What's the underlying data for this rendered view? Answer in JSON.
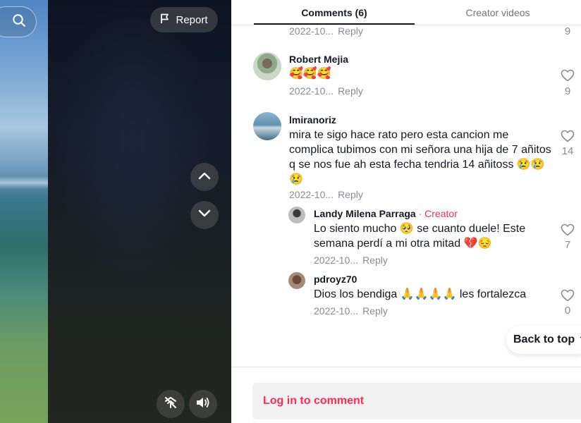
{
  "video": {
    "report_label": "Report"
  },
  "tabs": {
    "comments": "Comments (6)",
    "creator_videos": "Creator videos"
  },
  "comments": [
    {
      "date": "2022-10...",
      "reply_label": "Reply",
      "likes": "9"
    },
    {
      "username": "Robert Mejia",
      "text": "🥰🥰🥰",
      "date": "2022-10...",
      "reply_label": "Reply",
      "likes": "9"
    },
    {
      "username": "lmiranoriz",
      "text": "mira te sigo hace rato pero esta cancion me complica tubimos con mi señora una hija de 7 añitos q se nos fue ah esta fecha tendria 14 añitoss 😢😢😢",
      "date": "2022-10...",
      "reply_label": "Reply",
      "likes": "14",
      "replies": [
        {
          "username": "Landy Milena Parraga",
          "separator": "·",
          "creator_tag": "Creator",
          "text": "Lo siento mucho 🥺 se cuanto duele! Este semana perdí a mi otra mitad 💔😔",
          "date": "2022-10...",
          "reply_label": "Reply",
          "likes": "7"
        },
        {
          "username": "pdroyz70",
          "text": "Dios los bendiga 🙏🙏🙏🙏 les fortalezca",
          "date": "2022-10...",
          "reply_label": "Reply",
          "likes": "0"
        }
      ]
    }
  ],
  "back_to_top": "Back to top",
  "login_prompt": "Log in to comment",
  "colors": {
    "accent": "#fe2c55",
    "text": "#161823",
    "muted": "#8a8b91"
  },
  "icons": [
    "search-icon",
    "flag-icon",
    "chevron-up-icon",
    "chevron-down-icon",
    "mini-player-icon",
    "volume-icon",
    "heart-icon",
    "arrow-up-icon"
  ]
}
